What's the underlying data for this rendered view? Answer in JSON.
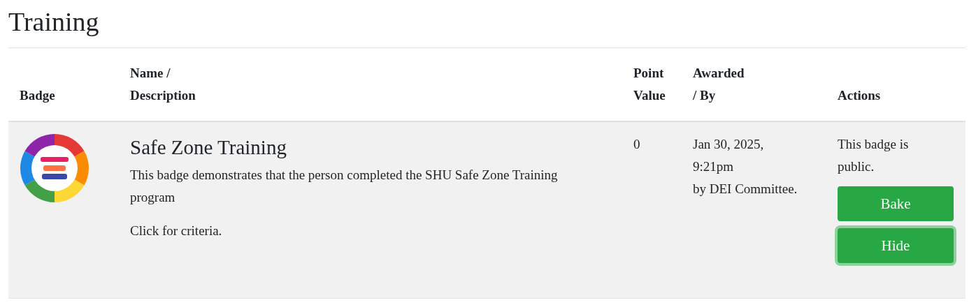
{
  "title": "Training",
  "table": {
    "columns": [
      {
        "lines": [
          "Badge"
        ]
      },
      {
        "lines": [
          "Name /",
          "Description"
        ]
      },
      {
        "lines": [
          "Point",
          "Value"
        ]
      },
      {
        "lines": [
          "Awarded",
          "/ By"
        ]
      },
      {
        "lines": [
          "Actions"
        ]
      }
    ],
    "rows": [
      {
        "name": "Safe Zone Training",
        "description": "This badge demonstrates that the person completed the SHU Safe Zone Training program",
        "criteria_link": "Click for criteria.",
        "point_value": "0",
        "awarded": "Jan 30, 2025, 9:21pm",
        "awarded_by": "by DEI Committee.",
        "visibility": "This badge is public.",
        "actions": [
          {
            "label": "Bake",
            "focused": false
          },
          {
            "label": "Hide",
            "focused": true
          }
        ]
      }
    ]
  }
}
